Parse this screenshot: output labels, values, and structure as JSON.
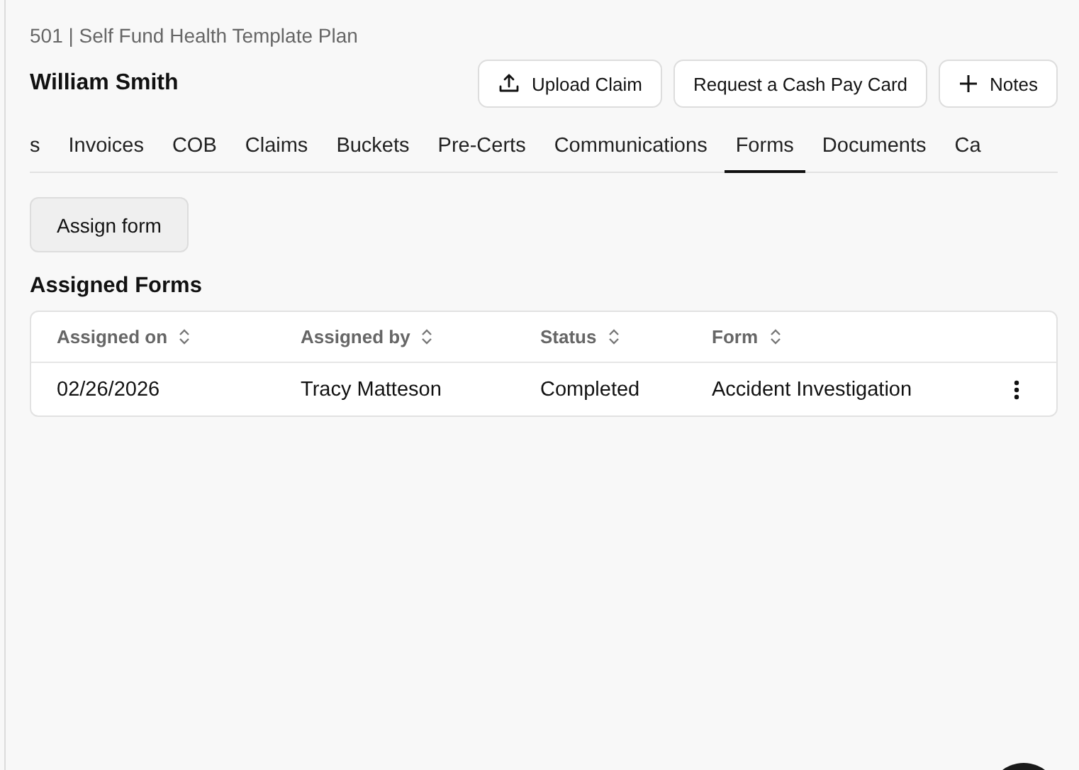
{
  "plan_label": "501 | Self Fund Health Template Plan",
  "member_name": "William Smith",
  "actions": [
    {
      "kind": "upload",
      "label": "Upload Claim"
    },
    {
      "kind": "plain",
      "label": "Request a Cash Pay Card"
    },
    {
      "kind": "add",
      "label": "Notes"
    }
  ],
  "tabs": [
    {
      "label": "s",
      "selected": false
    },
    {
      "label": "Invoices",
      "selected": false
    },
    {
      "label": "COB",
      "selected": false
    },
    {
      "label": "Claims",
      "selected": false
    },
    {
      "label": "Buckets",
      "selected": false
    },
    {
      "label": "Pre-Certs",
      "selected": false
    },
    {
      "label": "Communications",
      "selected": false
    },
    {
      "label": "Forms",
      "selected": true
    },
    {
      "label": "Documents",
      "selected": false
    },
    {
      "label": "Ca",
      "selected": false
    }
  ],
  "assign_button": "Assign form",
  "section_title": "Assigned Forms",
  "table": {
    "columns": [
      "Assigned on",
      "Assigned by",
      "Status",
      "Form"
    ],
    "rows": [
      {
        "cells": [
          "02/26/2026",
          "Tracy Matteson",
          "Completed",
          "Accident Investigation"
        ]
      }
    ]
  }
}
